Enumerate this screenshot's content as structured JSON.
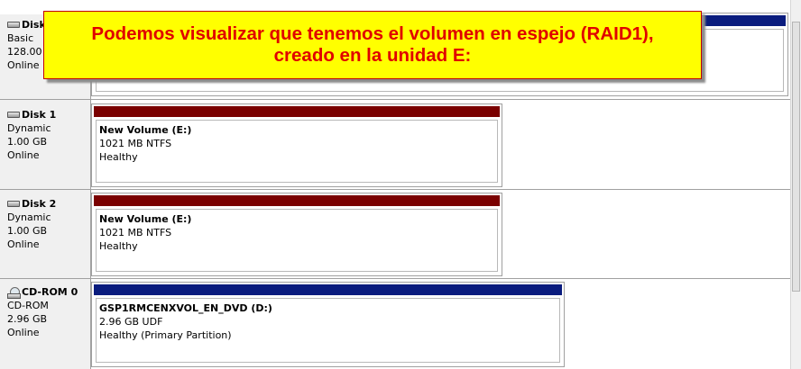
{
  "disk0": {
    "name": "Disk 0",
    "type": "Basic",
    "size": "128.00 GB",
    "status": "Online",
    "bar_color": "#0a1c7e"
  },
  "disk1": {
    "name": "Disk 1",
    "type": "Dynamic",
    "size": "1.00 GB",
    "status": "Online",
    "volume": {
      "title": "New Volume  (E:)",
      "info": "1021 MB NTFS",
      "status": "Healthy",
      "bar_color": "#7a0000"
    }
  },
  "disk2": {
    "name": "Disk 2",
    "type": "Dynamic",
    "size": "1.00 GB",
    "status": "Online",
    "volume": {
      "title": "New Volume  (E:)",
      "info": "1021 MB NTFS",
      "status": "Healthy",
      "bar_color": "#7a0000"
    }
  },
  "cdrom0": {
    "name": "CD-ROM 0",
    "type": "CD-ROM",
    "size": "2.96 GB",
    "status": "Online",
    "volume": {
      "title": "GSP1RMCENXVOL_EN_DVD  (D:)",
      "info": "2.96 GB UDF",
      "status": "Healthy (Primary Partition)",
      "bar_color": "#0a1c7e"
    }
  },
  "callout": {
    "line1": "Podemos visualizar que tenemos el volumen en espejo (RAID1),",
    "line2": "creado en la unidad E:"
  }
}
